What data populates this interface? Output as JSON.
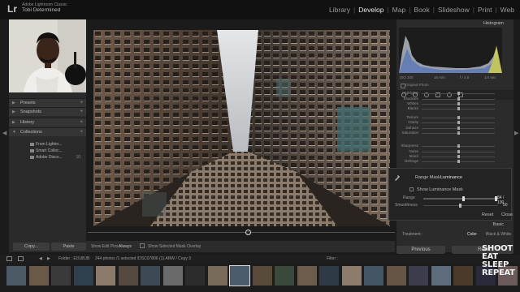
{
  "app": {
    "logo": "Lr",
    "app_name": "Adobe Lightroom Classic",
    "user": "Tobi Determined"
  },
  "modules": [
    {
      "label": "Library",
      "active": false
    },
    {
      "label": "Develop",
      "active": true
    },
    {
      "label": "Map",
      "active": false
    },
    {
      "label": "Book",
      "active": false
    },
    {
      "label": "Slideshow",
      "active": false
    },
    {
      "label": "Print",
      "active": false
    },
    {
      "label": "Web",
      "active": false
    }
  ],
  "left_panel": {
    "sections": [
      "Presets",
      "Snapshots",
      "History",
      "Collections"
    ],
    "collections": [
      {
        "label": "From Lightro...",
        "count": ""
      },
      {
        "label": "Smart Collec...",
        "count": ""
      },
      {
        "label": "Adobe Disco...",
        "count": "10"
      }
    ],
    "copy": "Copy...",
    "paste": "Paste"
  },
  "toolbar": {
    "show_edit_pins": "Show Edit Pins :",
    "pins_value": "Always",
    "show_overlay": "Show Selected Mask Overlay"
  },
  "right_panel": {
    "histogram_title": "Histogram",
    "readout": [
      "ISO 100",
      "16 mm",
      "f / 4.0",
      "1/4 sec"
    ],
    "original_photo": "Original Photo",
    "sliders": [
      {
        "label": "Highlights",
        "value": 0.5
      },
      {
        "label": "Shadows",
        "value": 0.5
      },
      {
        "label": "Whites",
        "value": 0.5
      },
      {
        "label": "Blacks",
        "value": 0.5
      },
      {
        "label": "Texture",
        "value": 0.5
      },
      {
        "label": "Clarity",
        "value": 0.5
      },
      {
        "label": "Dehaze",
        "value": 0.5
      },
      {
        "label": "Saturation",
        "value": 0.5
      },
      {
        "label": "Sharpness",
        "value": 0.5
      },
      {
        "label": "Noise",
        "value": 0.5
      },
      {
        "label": "Moiré",
        "value": 0.5
      },
      {
        "label": "Defringe",
        "value": 0.5
      }
    ]
  },
  "range_mask": {
    "label": "Range Mask :",
    "value": "Luminance",
    "show_mask": "Show Luminance Mask",
    "range_label": "Range",
    "range_value": "84 / 100",
    "smoothness_label": "Smoothness",
    "smoothness_value": "50",
    "reset": "Reset",
    "close": "Close"
  },
  "basic": {
    "title": "Basic",
    "treatment_label": "Treatment :",
    "color": "Color",
    "bw": "Black & White"
  },
  "buttons": {
    "previous": "Previous",
    "reset": "Reset"
  },
  "filmbar": {
    "folder": "Folder : EOUBJB",
    "count": "244 photos /1 selected /DSC07806 (1).ARW / Copy 3",
    "filter": "Filter :"
  },
  "watermark": [
    "SHOOT",
    "EAT",
    "SLEEP",
    "REPEAT"
  ],
  "colors": {
    "background": "#1b1b1b",
    "panel": "#2b2b2b",
    "active_module": "#e8e8e8"
  }
}
